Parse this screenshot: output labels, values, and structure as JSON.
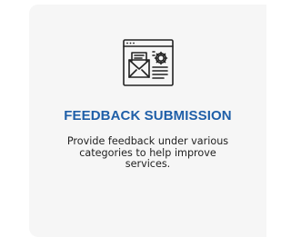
{
  "card": {
    "icon": "feedback-form-settings-icon",
    "title": "FEEDBACK SUBMISSION",
    "description": "Provide feedback under various categories to help improve services."
  },
  "colors": {
    "title": "#1f5fa8",
    "card_background": "#f6f6f6",
    "icon_stroke": "#222222"
  }
}
